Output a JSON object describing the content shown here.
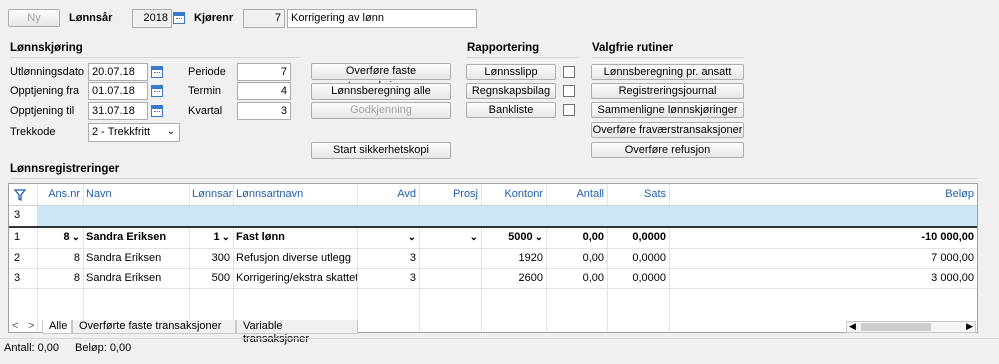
{
  "toolbar": {
    "ny_label": "Ny",
    "lonnsar_label": "Lønnsår",
    "lonnsar_value": "2018",
    "kjorenr_label": "Kjørenr",
    "kjorenr_value": "7",
    "kjorenr_desc": "Korrigering av  lønn"
  },
  "lonnskjoring": {
    "title": "Lønnskjøring",
    "utlonningsdato_label": "Utlønningsdato",
    "utlonningsdato_value": "20.07.18",
    "opptjening_fra_label": "Opptjening fra",
    "opptjening_fra_value": "01.07.18",
    "opptjening_til_label": "Opptjening til",
    "opptjening_til_value": "31.07.18",
    "trekkode_label": "Trekkode",
    "trekkode_value": "2 - Trekkfritt",
    "periode_label": "Periode",
    "periode_value": "7",
    "termin_label": "Termin",
    "termin_value": "4",
    "kvartal_label": "Kvartal",
    "kvartal_value": "3"
  },
  "actions": {
    "overfore_faste": "Overføre faste transaksjoner",
    "lonnsberegning_alle": "Lønnsberegning alle",
    "godkjenning": "Godkjenning",
    "start_sikkerhetskopi": "Start sikkerhetskopi"
  },
  "rapportering": {
    "title": "Rapportering",
    "lonnsslipp": "Lønnsslipp",
    "regnskapsbilag": "Regnskapsbilag",
    "bankliste": "Bankliste"
  },
  "valgfrie": {
    "title": "Valgfrie rutiner",
    "items": [
      "Lønnsberegning pr. ansatt",
      "Registreringsjournal",
      "Sammenligne lønnskjøringer",
      "Overføre fraværstransaksjoner",
      "Overføre refusjon"
    ]
  },
  "registreringer": {
    "title": "Lønnsregistreringer",
    "columns": [
      "Ans.nr",
      "Navn",
      "Lønnsart",
      "Lønnsartnavn",
      "Avd",
      "Prosj",
      "Kontonr",
      "Antall",
      "Sats",
      "Beløp"
    ],
    "filter_row_number": "3",
    "rows": [
      {
        "rownum": "1",
        "ansnr": "8",
        "navn": "Sandra Eriksen",
        "lonnsart": "1",
        "lonnsartnavn": "Fast lønn",
        "avd": "",
        "prosj": "",
        "kontonr": "5000",
        "antall": "0,00",
        "sats": "0,0000",
        "belop": "-10 000,00"
      },
      {
        "rownum": "2",
        "ansnr": "8",
        "navn": "Sandra Eriksen",
        "lonnsart": "300",
        "lonnsartnavn": "Refusjon diverse utlegg",
        "avd": "3",
        "prosj": "",
        "kontonr": "1920",
        "antall": "0,00",
        "sats": "0,0000",
        "belop": "7 000,00"
      },
      {
        "rownum": "3",
        "ansnr": "8",
        "navn": "Sandra Eriksen",
        "lonnsart": "500",
        "lonnsartnavn": "Korrigering/ekstra skattetrek",
        "avd": "3",
        "prosj": "",
        "kontonr": "2600",
        "antall": "0,00",
        "sats": "0,0000",
        "belop": "3 000,00"
      }
    ]
  },
  "tabs": [
    "Alle",
    "Overførte faste transaksjoner",
    "Variable transaksjoner"
  ],
  "status": {
    "antall": "Antall: 0,00",
    "belop": "Beløp: 0,00"
  },
  "colors": {
    "accent": "#1f5fa8",
    "selected_row": "#cce8f7"
  }
}
